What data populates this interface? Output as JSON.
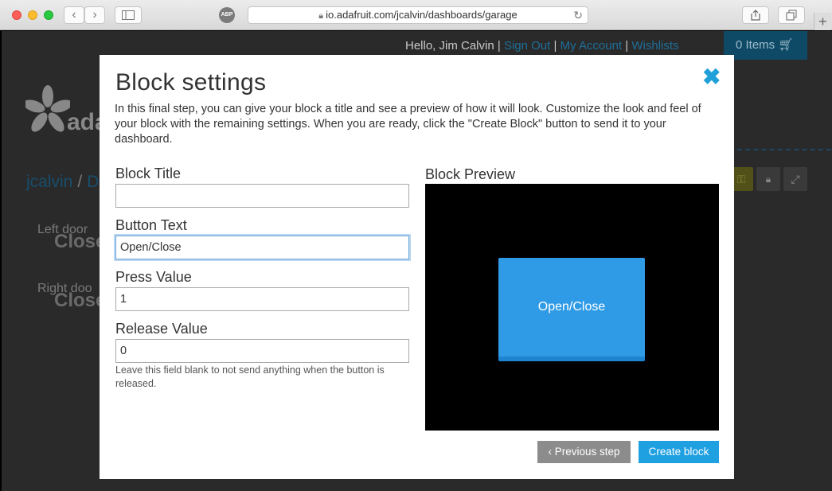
{
  "browser": {
    "url": "io.adafruit.com/jcalvin/dashboards/garage",
    "abp_label": "ABP"
  },
  "background": {
    "greeting": "Hello, Jim Calvin",
    "sign_out": "Sign Out",
    "my_account": "My Account",
    "wishlists": "Wishlists",
    "cart": "0 Items",
    "logo_text": "ada",
    "breadcrumb_user": "jcalvin",
    "breadcrumb_next": "D",
    "blocks": [
      {
        "label": "Left door",
        "value": "Close"
      },
      {
        "label": "Right doo",
        "value": "Close"
      }
    ]
  },
  "modal": {
    "title": "Block settings",
    "intro": "In this final step, you can give your block a title and see a preview of how it will look. Customize the look and feel of your block with the remaining settings. When you are ready, click the \"Create Block\" button to send it to your dashboard.",
    "fields": {
      "block_title": {
        "label": "Block Title",
        "value": ""
      },
      "button_text": {
        "label": "Button Text",
        "value": "Open/Close"
      },
      "press_value": {
        "label": "Press Value",
        "value": "1"
      },
      "release_value": {
        "label": "Release Value",
        "value": "0"
      }
    },
    "release_hint": "Leave this field blank to not send anything when the button is released.",
    "preview_label": "Block Preview",
    "preview_button": "Open/Close",
    "previous_step": "Previous step",
    "create_block": "Create block"
  },
  "colors": {
    "accent": "#1fa0e0",
    "preview_button": "#2f9be6",
    "secondary_button": "#8c8c8c"
  }
}
